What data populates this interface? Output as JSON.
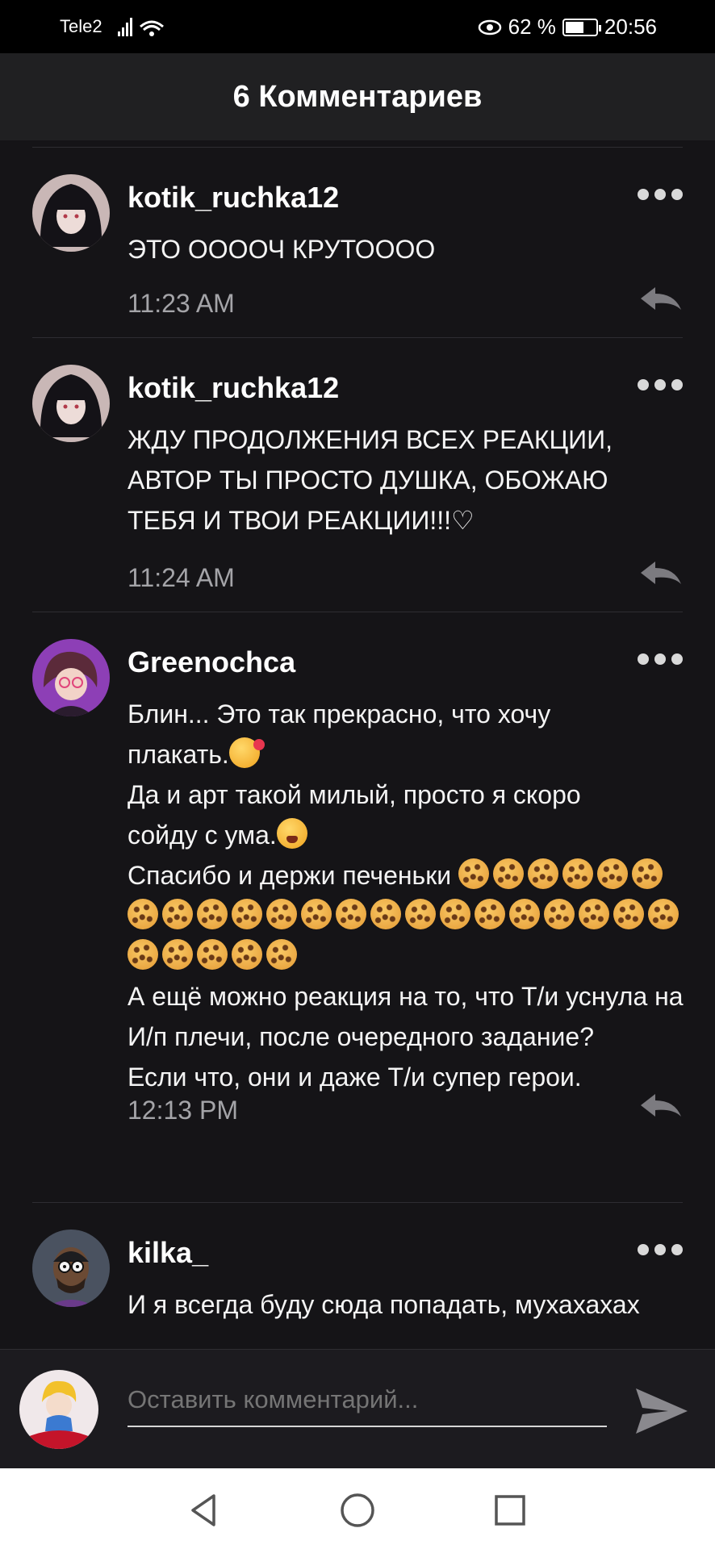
{
  "status_bar": {
    "carrier": "Tele2",
    "battery": "62 %",
    "battery_level": 0.62,
    "time": "20:56"
  },
  "header": {
    "title": "6 Комментариев"
  },
  "comments": [
    {
      "username": "kotik_ruchka12",
      "text": "ЭТО ООООЧ КРУТОООО",
      "time": "11:23 AM"
    },
    {
      "username": "kotik_ruchka12",
      "text": "ЖДУ ПРОДОЛЖЕНИЯ ВСЕХ РЕАКЦИИ, АВТОР ТЫ ПРОСТО ДУШКА, ОБОЖАЮ ТЕБЯ И ТВОИ РЕАКЦИИ!!!♡",
      "time": "11:24 AM"
    },
    {
      "username": "Greenochca",
      "text_line1": "Блин... Это так прекрасно, что хочу",
      "text_line2": "плакать.",
      "text_line3": "Да и арт такой милый, просто я скоро",
      "text_line4": "сойду с ума.",
      "text_line5": "Спасибо и держи печеньки",
      "cookie_count": 27,
      "text_line6": "А ещё можно реакция на то, что Т/и уснула на И/п плечи, после очередного задание?",
      "text_line7": "Если что, они и даже Т/и супер герои.",
      "time": "12:13 PM"
    },
    {
      "username": "kilka_",
      "text": "И я всегда буду сюда попадать, мухахахах"
    }
  ],
  "composer": {
    "placeholder": "Оставить комментарий..."
  },
  "icons": {
    "more": "more-dots-icon",
    "reply": "reply-arrow-icon",
    "send": "send-icon",
    "back": "nav-back-icon",
    "home": "nav-home-icon",
    "recents": "nav-recents-icon"
  }
}
